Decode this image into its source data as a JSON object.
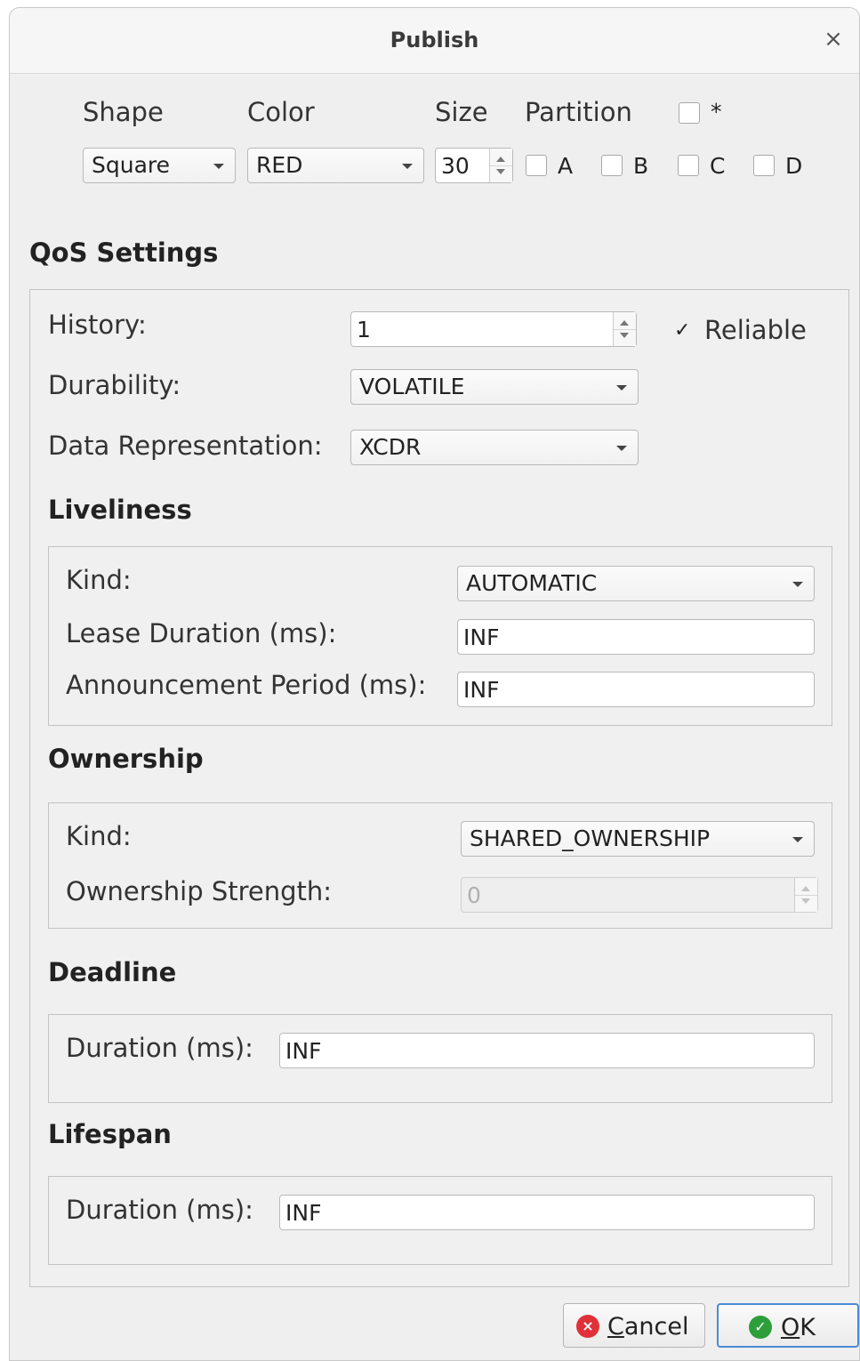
{
  "dialog": {
    "title": "Publish",
    "close_glyph": "×"
  },
  "top": {
    "shape_label": "Shape",
    "color_label": "Color",
    "size_label": "Size",
    "partition_label": "Partition",
    "shape_value": "Square",
    "color_value": "RED",
    "size_value": "30",
    "partitions": [
      {
        "label": "*",
        "checked": false
      },
      {
        "label": "A",
        "checked": false
      },
      {
        "label": "B",
        "checked": false
      },
      {
        "label": "C",
        "checked": false
      },
      {
        "label": "D",
        "checked": false
      }
    ]
  },
  "qos": {
    "title": "QoS Settings",
    "history_label": "History:",
    "history_value": "1",
    "reliable_label": "Reliable",
    "reliable_checked": true,
    "check_glyph": "✓",
    "durability_label": "Durability:",
    "durability_value": "VOLATILE",
    "datarep_label": "Data Representation:",
    "datarep_value": "XCDR"
  },
  "liveliness": {
    "title": "Liveliness",
    "kind_label": "Kind:",
    "kind_value": "AUTOMATIC",
    "lease_label": "Lease Duration (ms):",
    "lease_value": "INF",
    "announce_label": "Announcement Period (ms):",
    "announce_value": "INF"
  },
  "ownership": {
    "title": "Ownership",
    "kind_label": "Kind:",
    "kind_value": "SHARED_OWNERSHIP",
    "strength_label": "Ownership Strength:",
    "strength_value": "0"
  },
  "deadline": {
    "title": "Deadline",
    "duration_label": "Duration (ms):",
    "duration_value": "INF"
  },
  "lifespan": {
    "title": "Lifespan",
    "duration_label": "Duration (ms):",
    "duration_value": "INF"
  },
  "buttons": {
    "cancel_mnemonic": "C",
    "cancel_rest": "ancel",
    "ok_mnemonic": "O",
    "ok_rest": "K",
    "cancel_icon": "×",
    "ok_icon": "✓",
    "cancel_color": "#e0313a",
    "ok_color": "#2e9e3b"
  }
}
